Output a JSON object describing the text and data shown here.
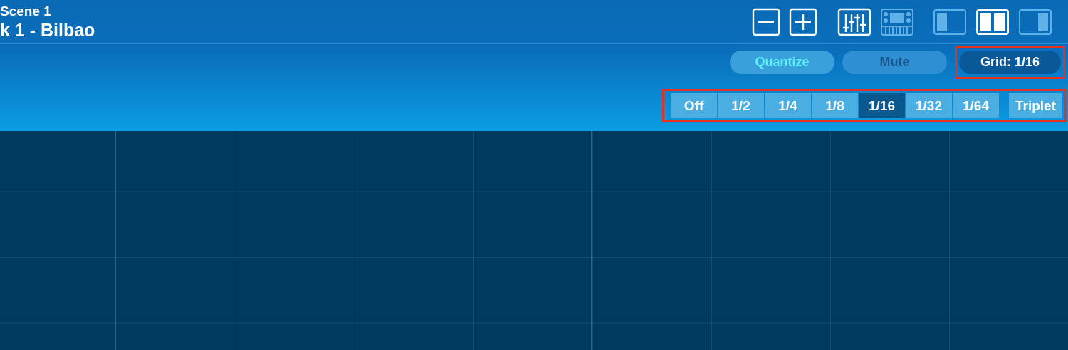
{
  "header": {
    "subtitle": "Scene 1",
    "title": "k 1 - Bilbao"
  },
  "zoom_buttons": [
    {
      "kind": "minus"
    },
    {
      "kind": "plus"
    }
  ],
  "view_buttons": [
    {
      "kind": "mixer",
      "selected": true
    },
    {
      "kind": "keyboard",
      "selected": false
    }
  ],
  "layout_buttons": [
    {
      "kind": "left",
      "selected": false
    },
    {
      "kind": "split",
      "selected": true
    },
    {
      "kind": "right",
      "selected": false
    }
  ],
  "actions": [
    {
      "label": "Quantize",
      "kind": "quantize",
      "disabled": false
    },
    {
      "label": "Mute",
      "kind": "mute",
      "disabled": true
    },
    {
      "label": "Grid: 1/16",
      "kind": "grid",
      "highlighted": true
    }
  ],
  "grid_picker": {
    "highlighted": true,
    "segments": [
      {
        "label": "Off",
        "selected": false
      },
      {
        "label": "1/2",
        "selected": false
      },
      {
        "label": "1/4",
        "selected": false
      },
      {
        "label": "1/8",
        "selected": false
      },
      {
        "label": "1/16",
        "selected": true
      },
      {
        "label": "1/32",
        "selected": false
      },
      {
        "label": "1/64",
        "selected": false
      }
    ],
    "triplet": {
      "label": "Triplet",
      "selected": false
    }
  }
}
